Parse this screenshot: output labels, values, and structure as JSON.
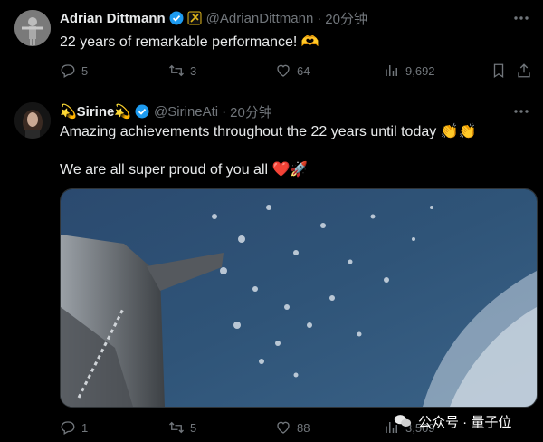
{
  "tweets": [
    {
      "author_name": "Adrian Dittmann",
      "handle": "@AdrianDittmann",
      "time": "20分钟",
      "text": "22 years of remarkable performance! 🫶",
      "replies": "5",
      "reposts": "3",
      "likes": "64",
      "views": "9,692"
    },
    {
      "author_name": "💫Sirine💫",
      "handle": "@SirineAti",
      "time": "20分钟",
      "text_line1": "Amazing achievements throughout the 22 years until today 👏👏",
      "text_line2": "We are all super proud of you all ❤️🚀",
      "replies": "1",
      "reposts": "5",
      "likes": "88",
      "views": "3,509"
    }
  ],
  "watermark": {
    "label": "公众号 · 量子位"
  },
  "colors": {
    "background": "#000000",
    "text": "#e7e9ea",
    "muted": "#71767b",
    "verified": "#1d9bf0",
    "gold": "#e2b719",
    "divider": "#2f3336"
  }
}
